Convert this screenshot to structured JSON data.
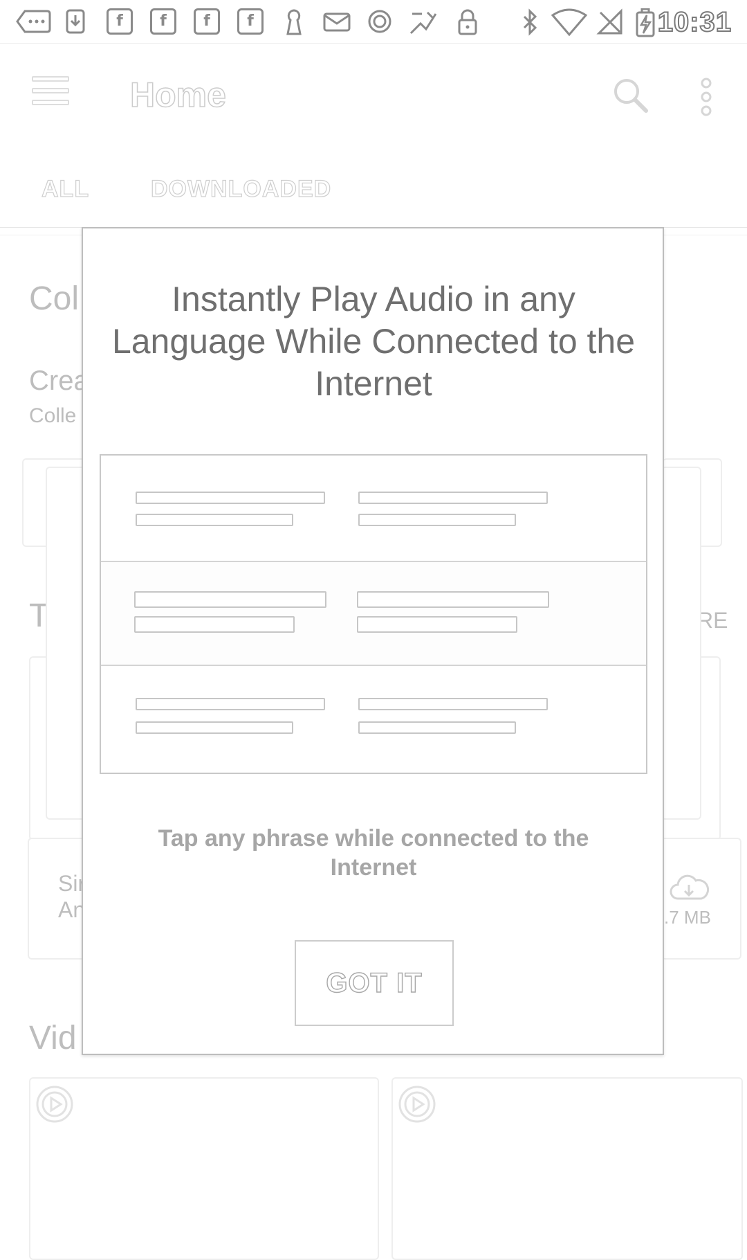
{
  "status_bar": {
    "time": "10:31",
    "icons": [
      "more-dots-icon",
      "download-icon",
      "facebook-icon",
      "facebook-icon",
      "facebook-icon",
      "facebook-icon",
      "keyhole-icon",
      "mail-icon",
      "sync-icon",
      "app-icon",
      "lock-icon",
      "bluetooth-icon",
      "wifi-icon",
      "no-sim-icon",
      "battery-charging-icon"
    ],
    "facebook_glyph": "f"
  },
  "toolbar": {
    "title": "Home"
  },
  "tabs": [
    {
      "label": "ALL"
    },
    {
      "label": "DOWNLOADED"
    }
  ],
  "background": {
    "section_col": "Col",
    "create_line": "Crea",
    "collection_line": "Colle",
    "section_t": "T",
    "more_fragment": "RE",
    "item_line1": "Sir",
    "item_line2": "An",
    "size_fragment": ".7 MB",
    "section_vid": "Vid"
  },
  "dialog": {
    "title": "Instantly Play Audio in any Language While Connected to the Internet",
    "hint": "Tap any phrase while connected to the Internet",
    "button": "GOT IT"
  }
}
